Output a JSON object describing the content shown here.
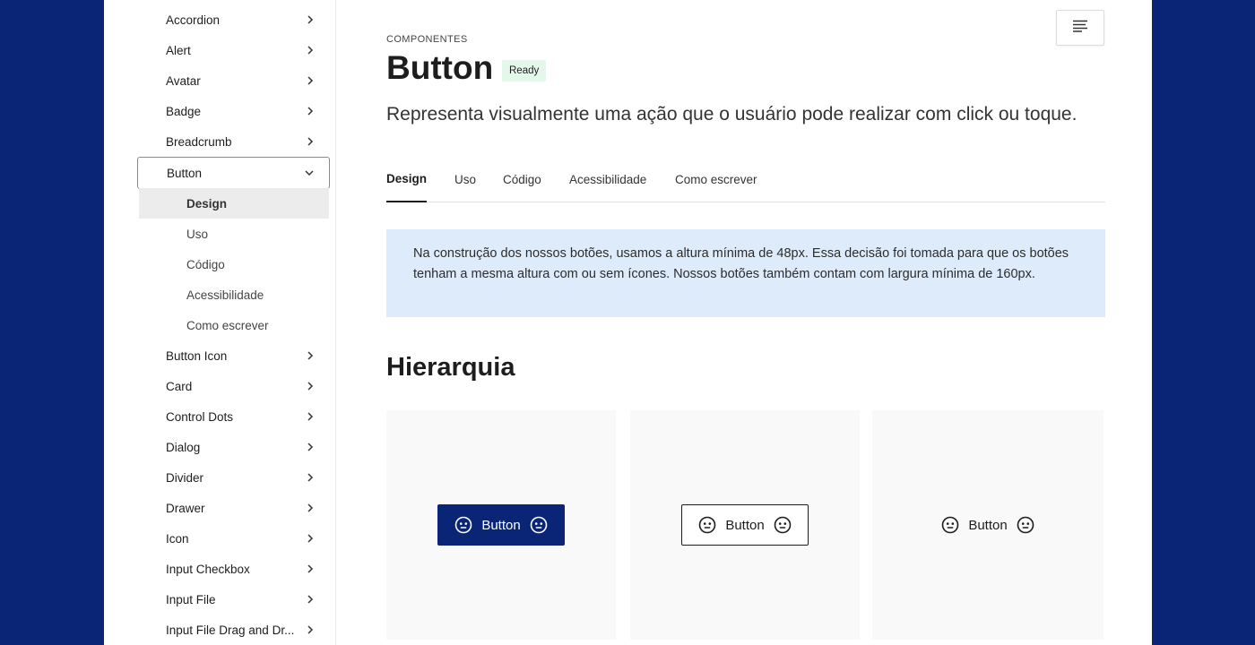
{
  "sidebar": {
    "items_before": [
      "Accordion",
      "Alert",
      "Avatar",
      "Badge",
      "Breadcrumb"
    ],
    "open_item": "Button",
    "sub_items": [
      "Design",
      "Uso",
      "Código",
      "Acessibilidade",
      "Como escrever"
    ],
    "active_sub_item": "Design",
    "items_after": [
      "Button Icon",
      "Card",
      "Control Dots",
      "Dialog",
      "Divider",
      "Drawer",
      "Icon",
      "Input Checkbox",
      "Input File",
      "Input File Drag and Dr..."
    ]
  },
  "header": {
    "overline": "COMPONENTES",
    "title": "Button",
    "badge": "Ready",
    "subtitle": "Representa visualmente uma ação que o usuário pode realizar com click ou toque."
  },
  "tabs": {
    "items": [
      "Design",
      "Uso",
      "Código",
      "Acessibilidade",
      "Como escrever"
    ],
    "active": "Design"
  },
  "info": {
    "text": "Na construção dos nossos botões, usamos a altura mínima de 48px. Essa decisão foi tomada para que os botões tenham a mesma altura com ou sem ícones. Nossos botões também contam com largura mínima de 160px."
  },
  "section": {
    "title": "Hierarquia"
  },
  "examples": {
    "primary_label": "Button",
    "secondary_label": "Button",
    "tertiary_label": "Button"
  },
  "colors": {
    "brand": "#0b2576",
    "info_bg": "#deebfb",
    "badge_bg": "#e3f8ea"
  },
  "icons": {
    "chevron": "chevron-right-icon",
    "chevron_open": "chevron-down-icon",
    "menu": "menu-lines-icon",
    "face": "smiley-face-icon"
  }
}
